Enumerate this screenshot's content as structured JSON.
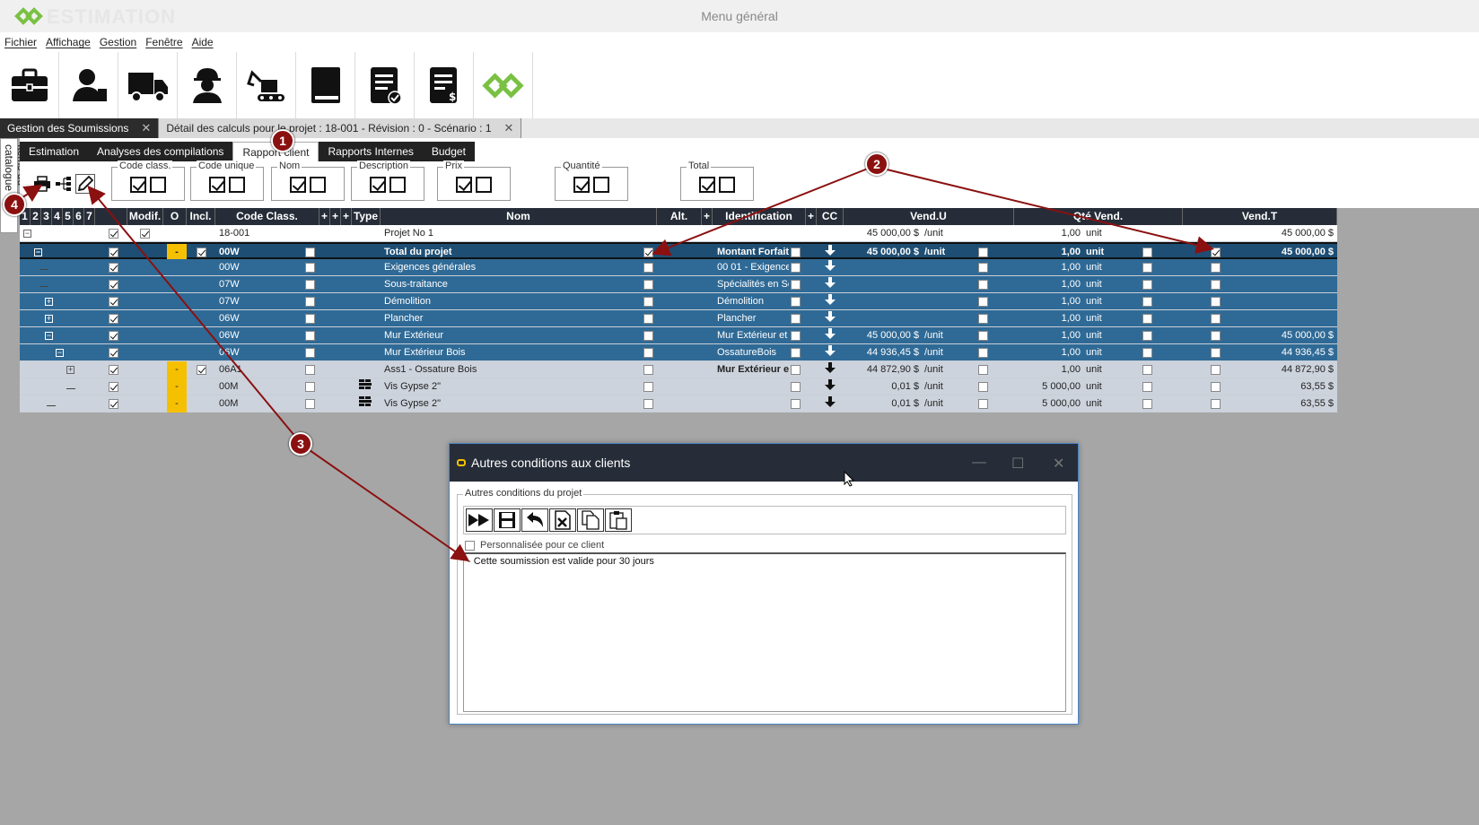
{
  "app": {
    "logo_text": "ESTIMATION",
    "window_title": "Menu général"
  },
  "menu": [
    "Fichier",
    "Affichage",
    "Gestion",
    "Fenêtre",
    "Aide"
  ],
  "toolbar_icons": [
    "briefcase-icon",
    "client-icon",
    "truck-icon",
    "worker-icon",
    "excavator-icon",
    "book-icon",
    "document-check-icon",
    "invoice-icon",
    "logo-icon"
  ],
  "doc_tabs": [
    {
      "label": "Gestion des Soumissions",
      "active": false
    },
    {
      "label": "Détail des calculs pour le projet : 18-001 - Révision : 0 - Scénario : 1",
      "active": true
    }
  ],
  "side_tab": "Items du catalogue",
  "sub_tabs": [
    "Estimation",
    "Analyses des compilations",
    "Rapport client",
    "Rapports Internes",
    "Budget"
  ],
  "active_sub_tab": "Rapport client",
  "option_groups": [
    {
      "label": "Code class."
    },
    {
      "label": "Code unique"
    },
    {
      "label": "Nom"
    },
    {
      "label": "Description"
    },
    {
      "label": "Prix"
    },
    {
      "label": "Quantité"
    },
    {
      "label": "Total"
    }
  ],
  "grid": {
    "headers": {
      "levels": [
        "1",
        "2",
        "3",
        "4",
        "5",
        "6",
        "7"
      ],
      "modif": "Modif.",
      "o": "O",
      "incl": "Incl.",
      "code_class": "Code Class.",
      "plus": "+",
      "type": "Type",
      "nom": "Nom",
      "alt": "Alt.",
      "identification": "Identification",
      "cc": "CC",
      "vend_u": "Vend.U",
      "qte_vend": "Qté Vend.",
      "vend_t": "Vend.T"
    },
    "rows": [
      {
        "style": "white",
        "code": "18-001",
        "nom": "Projet No 1",
        "ident": "",
        "vend_u": "45 000,00 $",
        "unit_u": "/unit",
        "qty": "1,00",
        "unit": "unit",
        "total": "45 000,00 $"
      },
      {
        "style": "dark",
        "code": "00W",
        "nom": "Total du projet",
        "ident": "Montant Forfait",
        "vend_u": "45 000,00 $",
        "unit_u": "/unit",
        "qty": "1,00",
        "unit": "unit",
        "total": "45 000,00 $"
      },
      {
        "style": "blue",
        "code": "00W",
        "nom": "Exigences générales",
        "ident": "00 01 - Exigence",
        "vend_u": "",
        "unit_u": "",
        "qty": "1,00",
        "unit": "unit",
        "total": ""
      },
      {
        "style": "blue",
        "code": "07W",
        "nom": "Sous-traitance",
        "ident": "Spécialités en Sc",
        "vend_u": "",
        "unit_u": "",
        "qty": "1,00",
        "unit": "unit",
        "total": ""
      },
      {
        "style": "blue",
        "code": "07W",
        "nom": "Démolition",
        "ident": "Démolition",
        "vend_u": "",
        "unit_u": "",
        "qty": "1,00",
        "unit": "unit",
        "total": ""
      },
      {
        "style": "blue",
        "code": "06W",
        "nom": "Plancher",
        "ident": "Plancher",
        "vend_u": "",
        "unit_u": "",
        "qty": "1,00",
        "unit": "unit",
        "total": ""
      },
      {
        "style": "blue",
        "code": "06W",
        "nom": "Mur Extérieur",
        "ident": "Mur Extérieur et",
        "vend_u": "45 000,00 $",
        "unit_u": "/unit",
        "qty": "1,00",
        "unit": "unit",
        "total": "45 000,00 $"
      },
      {
        "style": "blue",
        "code": "06W",
        "nom": "Mur Extérieur Bois",
        "ident": "OssatureBois",
        "vend_u": "44 936,45 $",
        "unit_u": "/unit",
        "qty": "1,00",
        "unit": "unit",
        "total": "44 936,45 $"
      },
      {
        "style": "gray",
        "code": "06A1",
        "nom": "Ass1 - Ossature Bois",
        "ident": "Mur Extérieur e",
        "vend_u": "44 872,90 $",
        "unit_u": "/unit",
        "qty": "1,00",
        "unit": "unit",
        "total": "44 872,90 $"
      },
      {
        "style": "gray",
        "code": "00M",
        "nom": "Vis Gypse 2\"",
        "ident": "",
        "vend_u": "0,01 $",
        "unit_u": "/unit",
        "qty": "5 000,00",
        "unit": "unit",
        "total": "63,55 $"
      },
      {
        "style": "gray",
        "code": "00M",
        "nom": "Vis Gypse 2\"",
        "ident": "",
        "vend_u": "0,01 $",
        "unit_u": "/unit",
        "qty": "5 000,00",
        "unit": "unit",
        "total": "63,55 $"
      }
    ]
  },
  "dialog": {
    "title": "Autres conditions aux clients",
    "group_label": "Autres conditions du projet",
    "checkbox_label": "Personnalisée pour ce client",
    "text": "- Cette soumission est valide pour 30 jours"
  },
  "annotations": [
    "1",
    "2",
    "3",
    "4"
  ],
  "colors": {
    "accent_green": "#7ac143",
    "header_dark": "#262d38",
    "row_blue": "#2f6a96",
    "annotation_red": "#8b1010",
    "option_yellow": "#f5c000"
  }
}
